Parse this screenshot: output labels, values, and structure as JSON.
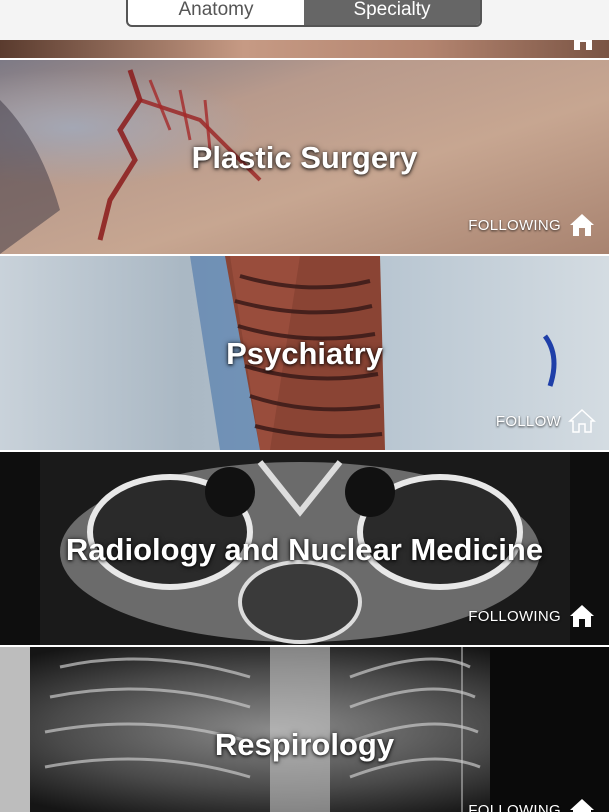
{
  "tabs": {
    "anatomy": "Anatomy",
    "specialty": "Specialty"
  },
  "specialties": [
    {
      "title": "Plastic Surgery",
      "status": "FOLLOWING"
    },
    {
      "title": "Psychiatry",
      "status": "FOLLOW"
    },
    {
      "title": "Radiology and Nuclear Medicine",
      "status": "FOLLOWING"
    },
    {
      "title": "Respirology",
      "status": "FOLLOWING"
    }
  ]
}
